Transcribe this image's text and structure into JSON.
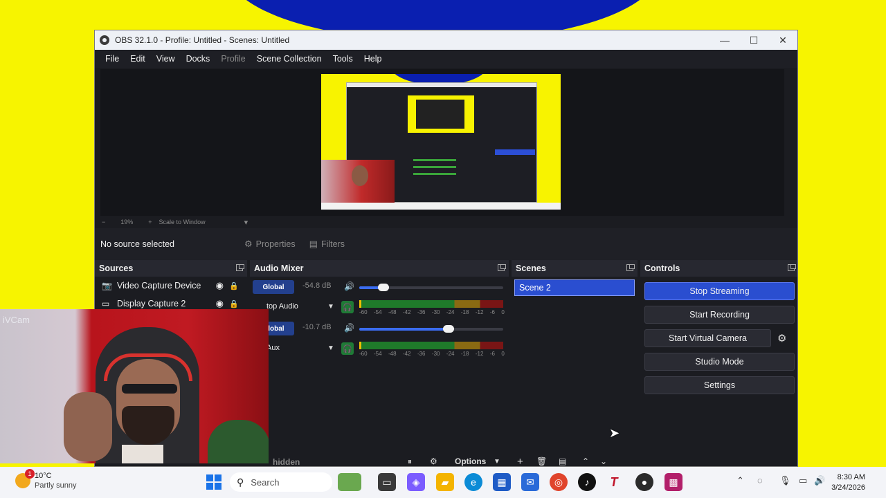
{
  "window": {
    "title": "OBS 32.1.0 - Profile: Untitled - Scenes: Untitled",
    "minimize": "—",
    "maximize": "☐",
    "close": "✕"
  },
  "menu": [
    "File",
    "Edit",
    "View",
    "Docks",
    "Profile",
    "Scene Collection",
    "Tools",
    "Help"
  ],
  "zoom": {
    "minus": "−",
    "value": "19%",
    "plus": "+",
    "mode": "Scale to Window",
    "caret": "▾"
  },
  "source_toolbar": {
    "no_source": "No source selected",
    "properties": "Properties",
    "filters": "Filters"
  },
  "docks": {
    "sources": "Sources",
    "audio_mixer": "Audio Mixer",
    "scenes": "Scenes",
    "controls": "Controls"
  },
  "sources": {
    "items": [
      {
        "name": "Video Capture Device"
      },
      {
        "name": "Display Capture 2"
      }
    ],
    "footer_label": "hidden"
  },
  "mixer": {
    "tracks": [
      {
        "tag": "Global",
        "db": "-54.8 dB",
        "name": "top Audio",
        "volume_pct": 17
      },
      {
        "tag": "Global",
        "db": "-10.7 dB",
        "name": "Aux",
        "volume_pct": 62
      }
    ],
    "ticks": [
      "-60",
      "-54",
      "-48",
      "-42",
      "-36",
      "-30",
      "-24",
      "-18",
      "-12",
      "-6",
      "0"
    ],
    "options": "Options"
  },
  "scenes": {
    "items": [
      "Scene 2"
    ]
  },
  "controls": {
    "stop_streaming": "Stop Streaming",
    "start_recording": "Start Recording",
    "start_virtual_camera": "Start Virtual Camera",
    "studio_mode": "Studio Mode",
    "settings": "Settings"
  },
  "webcam": {
    "watermark": "iVCam"
  },
  "taskbar": {
    "weather": {
      "temp": "10°C",
      "condition": "Partly sunny",
      "badge": "1"
    },
    "search": "Search",
    "time": "8:30 AM",
    "date": "3/24/2026"
  },
  "colors": {
    "accent_blue": "#2a4ed0",
    "wallpaper_yellow": "#f7f400",
    "wallpaper_blue": "#0a1fb0",
    "obs_bg": "#1b1c21"
  }
}
